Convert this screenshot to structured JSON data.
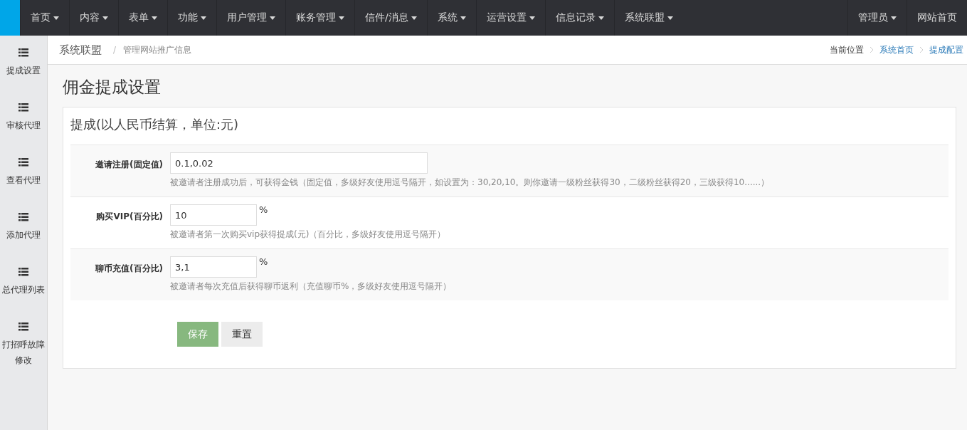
{
  "top_nav": {
    "items": [
      {
        "label": "首页",
        "dropdown": true
      },
      {
        "label": "内容",
        "dropdown": true
      },
      {
        "label": "表单",
        "dropdown": true
      },
      {
        "label": "功能",
        "dropdown": true
      },
      {
        "label": "用户管理",
        "dropdown": true
      },
      {
        "label": "账务管理",
        "dropdown": true
      },
      {
        "label": "信件/消息",
        "dropdown": true
      },
      {
        "label": "系统",
        "dropdown": true
      },
      {
        "label": "运营设置",
        "dropdown": true
      },
      {
        "label": "信息记录",
        "dropdown": true
      },
      {
        "label": "系统联盟",
        "dropdown": true
      }
    ],
    "right_items": [
      {
        "label": "管理员",
        "dropdown": true
      },
      {
        "label": "网站首页",
        "dropdown": false
      }
    ]
  },
  "sidebar": {
    "items": [
      {
        "label": "提成设置"
      },
      {
        "label": "审核代理"
      },
      {
        "label": "查看代理"
      },
      {
        "label": "添加代理"
      },
      {
        "label": "总代理列表"
      },
      {
        "label": "打招呼故障修改"
      }
    ]
  },
  "header": {
    "title": "系统联盟",
    "separator": "/",
    "subtitle": "管理网站推广信息",
    "breadcrumb_label": "当前位置",
    "breadcrumb": [
      "系统首页",
      "提成配置"
    ]
  },
  "page_title": "佣金提成设置",
  "panel": {
    "title": "提成(以人民币结算，单位:元)",
    "fields": [
      {
        "label": "邀请注册(固定值)",
        "value": "0.1,0.02",
        "wide": true,
        "help": "被邀请者注册成功后，可获得金钱（固定值，多级好友使用逗号隔开，如设置为：30,20,10。则你邀请一级粉丝获得30，二级粉丝获得20，三级获得10......）"
      },
      {
        "label": "购买VIP(百分比)",
        "value": "10",
        "wide": false,
        "unit": "%",
        "help": "被邀请者第一次购买vip获得提成(元)（百分比，多级好友使用逗号隔开）"
      },
      {
        "label": "聊币充值(百分比)",
        "value": "3,1",
        "wide": false,
        "unit": "%",
        "help": "被邀请者每次充值后获得聊币返利（充值聊币%，多级好友使用逗号隔开）"
      }
    ],
    "buttons": [
      {
        "label": "保存",
        "kind": "primary"
      },
      {
        "label": "重置",
        "kind": "default"
      }
    ]
  }
}
